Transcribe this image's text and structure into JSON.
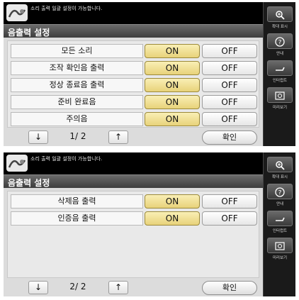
{
  "screens": [
    {
      "message": "소리 출력 일괄 설정이 가능합니다.",
      "title": "음출력 설정",
      "rows": [
        {
          "label": "모든 소리",
          "on": "ON",
          "off": "OFF"
        },
        {
          "label": "조작 확인음 출력",
          "on": "ON",
          "off": "OFF"
        },
        {
          "label": "정상 종료음 출력",
          "on": "ON",
          "off": "OFF"
        },
        {
          "label": "준비 완료음",
          "on": "ON",
          "off": "OFF"
        },
        {
          "label": "주의음",
          "on": "ON",
          "off": "OFF"
        }
      ],
      "page_indicator": "1/ 2",
      "down_arrow": "↓",
      "up_arrow": "↑",
      "confirm": "확인"
    },
    {
      "message": "소리 출력 일괄 설정이 가능합니다.",
      "title": "음출력 설정",
      "rows": [
        {
          "label": "삭제음 출력",
          "on": "ON",
          "off": "OFF"
        },
        {
          "label": "인증음 출력",
          "on": "ON",
          "off": "OFF"
        }
      ],
      "page_indicator": "2/ 2",
      "down_arrow": "↓",
      "up_arrow": "↑",
      "confirm": "확인"
    }
  ],
  "side_panel": [
    {
      "icon": "zoom-icon",
      "label": "확대 표시"
    },
    {
      "icon": "help-icon",
      "label": "안내"
    },
    {
      "icon": "interrupt-icon",
      "label": "인터럽트"
    },
    {
      "icon": "preview-icon",
      "label": "미리보기"
    }
  ],
  "colors": {
    "on_button": "#e8d27a",
    "title_bar": "#4a4a4a",
    "background": "#dcdcdc"
  }
}
